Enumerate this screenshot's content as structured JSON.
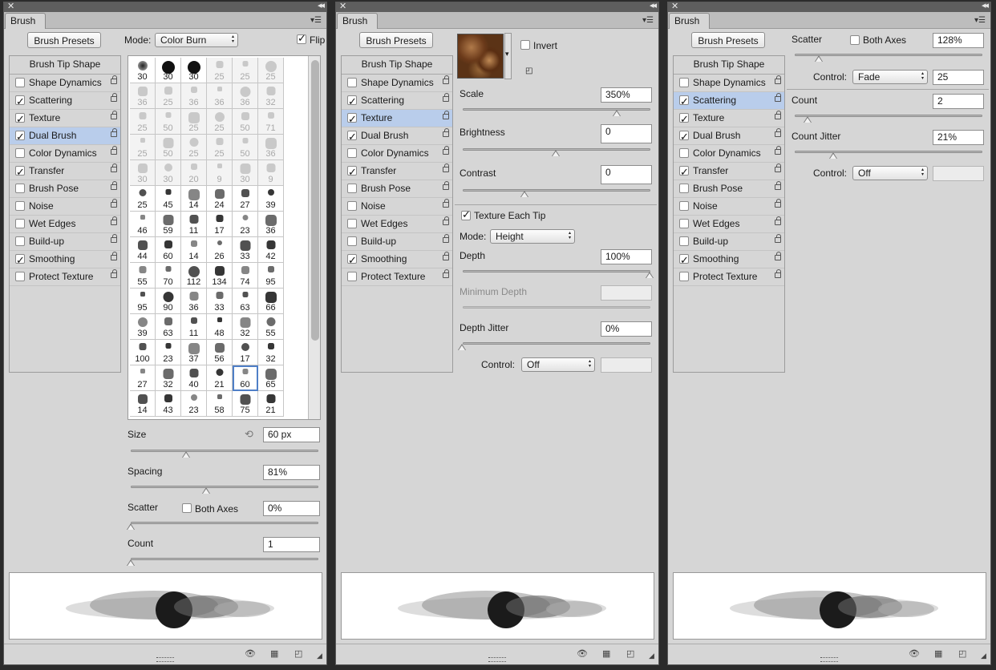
{
  "panel_title": "Brush",
  "brush_presets_label": "Brush Presets",
  "sidebar_head": "Brush Tip Shape",
  "panels": [
    {
      "items": [
        {
          "label": "Shape Dynamics",
          "checked": false,
          "selected": false
        },
        {
          "label": "Scattering",
          "checked": true,
          "selected": false
        },
        {
          "label": "Texture",
          "checked": true,
          "selected": false
        },
        {
          "label": "Dual Brush",
          "checked": true,
          "selected": true
        },
        {
          "label": "Color Dynamics",
          "checked": false,
          "selected": false
        },
        {
          "label": "Transfer",
          "checked": true,
          "selected": false
        },
        {
          "label": "Brush Pose",
          "checked": false,
          "selected": false
        },
        {
          "label": "Noise",
          "checked": false,
          "selected": false
        },
        {
          "label": "Wet Edges",
          "checked": false,
          "selected": false
        },
        {
          "label": "Build-up",
          "checked": false,
          "selected": false
        },
        {
          "label": "Smoothing",
          "checked": true,
          "selected": false
        },
        {
          "label": "Protect Texture",
          "checked": false,
          "selected": false
        }
      ],
      "mode_label": "Mode:",
      "mode_value": "Color Burn",
      "flip_label": "Flip",
      "tips": [
        "30",
        "30",
        "30",
        "25",
        "25",
        "25",
        "36",
        "25",
        "36",
        "36",
        "36",
        "32",
        "25",
        "50",
        "25",
        "25",
        "50",
        "71",
        "25",
        "50",
        "25",
        "25",
        "50",
        "36",
        "30",
        "30",
        "20",
        "9",
        "30",
        "9",
        "25",
        "45",
        "14",
        "24",
        "27",
        "39",
        "46",
        "59",
        "11",
        "17",
        "23",
        "36",
        "44",
        "60",
        "14",
        "26",
        "33",
        "42",
        "55",
        "70",
        "112",
        "134",
        "74",
        "95",
        "95",
        "90",
        "36",
        "33",
        "63",
        "66",
        "39",
        "63",
        "11",
        "48",
        "32",
        "55",
        "100",
        "23",
        "37",
        "56",
        "17",
        "32",
        "27",
        "32",
        "40",
        "21",
        "60",
        "65",
        "14",
        "43",
        "23",
        "58",
        "75",
        "21"
      ],
      "size_label": "Size",
      "size_value": "60 px",
      "spacing_label": "Spacing",
      "spacing_value": "81%",
      "scatter_label": "Scatter",
      "both_axes_label": "Both Axes",
      "scatter_value": "0%",
      "count_label": "Count",
      "count_value": "1"
    },
    {
      "items": [
        {
          "label": "Shape Dynamics",
          "checked": false,
          "selected": false
        },
        {
          "label": "Scattering",
          "checked": true,
          "selected": false
        },
        {
          "label": "Texture",
          "checked": true,
          "selected": true
        },
        {
          "label": "Dual Brush",
          "checked": true,
          "selected": false
        },
        {
          "label": "Color Dynamics",
          "checked": false,
          "selected": false
        },
        {
          "label": "Transfer",
          "checked": true,
          "selected": false
        },
        {
          "label": "Brush Pose",
          "checked": false,
          "selected": false
        },
        {
          "label": "Noise",
          "checked": false,
          "selected": false
        },
        {
          "label": "Wet Edges",
          "checked": false,
          "selected": false
        },
        {
          "label": "Build-up",
          "checked": false,
          "selected": false
        },
        {
          "label": "Smoothing",
          "checked": true,
          "selected": false
        },
        {
          "label": "Protect Texture",
          "checked": false,
          "selected": false
        }
      ],
      "invert_label": "Invert",
      "scale_label": "Scale",
      "scale_value": "350%",
      "brightness_label": "Brightness",
      "brightness_value": "0",
      "contrast_label": "Contrast",
      "contrast_value": "0",
      "texture_each_tip_label": "Texture Each Tip",
      "mode_label": "Mode:",
      "mode_value": "Height",
      "depth_label": "Depth",
      "depth_value": "100%",
      "min_depth_label": "Minimum Depth",
      "depth_jitter_label": "Depth Jitter",
      "depth_jitter_value": "0%",
      "control_label": "Control:",
      "control_value": "Off"
    },
    {
      "items": [
        {
          "label": "Shape Dynamics",
          "checked": false,
          "selected": false
        },
        {
          "label": "Scattering",
          "checked": true,
          "selected": true
        },
        {
          "label": "Texture",
          "checked": true,
          "selected": false
        },
        {
          "label": "Dual Brush",
          "checked": true,
          "selected": false
        },
        {
          "label": "Color Dynamics",
          "checked": false,
          "selected": false
        },
        {
          "label": "Transfer",
          "checked": true,
          "selected": false
        },
        {
          "label": "Brush Pose",
          "checked": false,
          "selected": false
        },
        {
          "label": "Noise",
          "checked": false,
          "selected": false
        },
        {
          "label": "Wet Edges",
          "checked": false,
          "selected": false
        },
        {
          "label": "Build-up",
          "checked": false,
          "selected": false
        },
        {
          "label": "Smoothing",
          "checked": true,
          "selected": false
        },
        {
          "label": "Protect Texture",
          "checked": false,
          "selected": false
        }
      ],
      "scatter_label": "Scatter",
      "both_axes_label": "Both Axes",
      "scatter_value": "128%",
      "control_label": "Control:",
      "control1_value": "Fade",
      "fade_value": "25",
      "count_label": "Count",
      "count_value": "2",
      "count_jitter_label": "Count Jitter",
      "count_jitter_value": "21%",
      "control2_value": "Off"
    }
  ],
  "icons": [
    "close-icon",
    "collapse-icon",
    "panel-menu-icon",
    "lock-icon",
    "reset-icon",
    "eye-icon",
    "grid-icon",
    "new-preset-icon",
    "resize-grip-icon"
  ]
}
